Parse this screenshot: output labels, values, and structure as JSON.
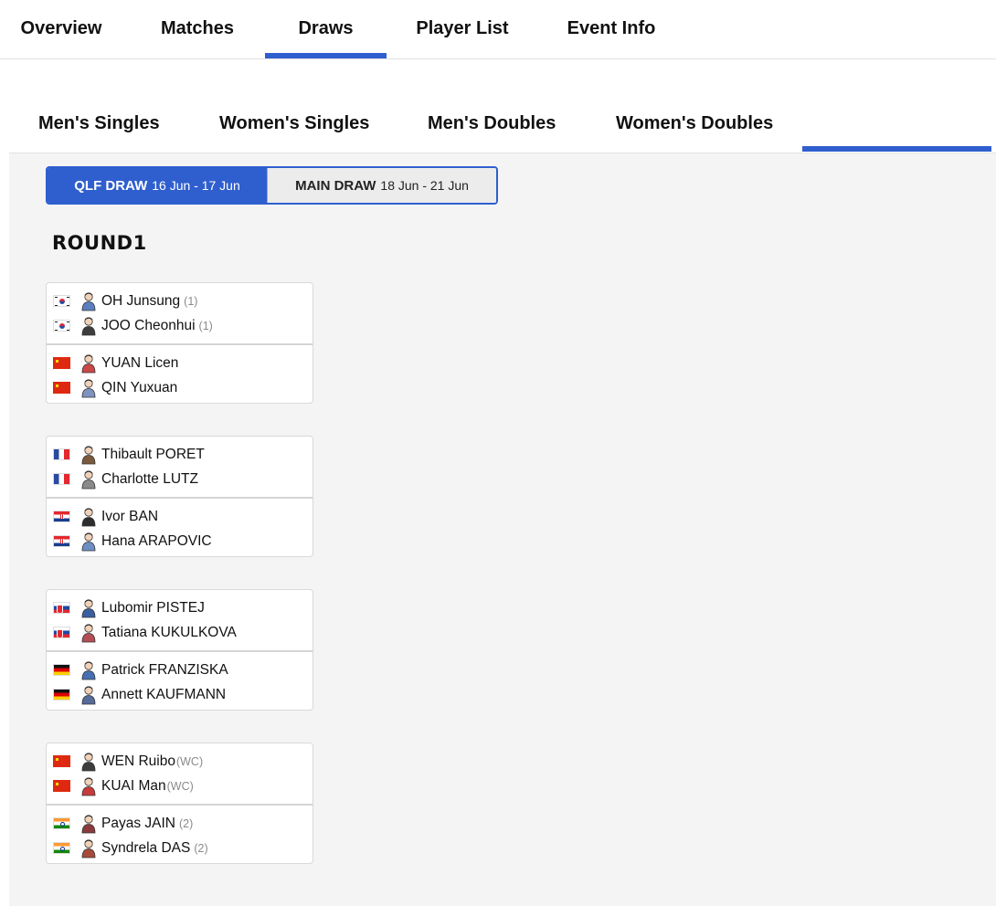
{
  "top_tabs": [
    "Overview",
    "Matches",
    "Draws",
    "Player List",
    "Event Info"
  ],
  "active_top_tab": "Draws",
  "sub_tabs": [
    "Men's Singles",
    "Women's Singles",
    "Men's Doubles",
    "Women's Doubles"
  ],
  "accent_color": "#2f5fce",
  "draw_toggle": {
    "qlf": {
      "label": "QLF DRAW",
      "dates": "16 Jun - 17 Jun"
    },
    "main": {
      "label": "MAIN DRAW",
      "dates": "18 Jun - 21 Jun"
    }
  },
  "round_title": "ROUND1",
  "matches": [
    {
      "team1": [
        {
          "flag": "KOR",
          "name": "OH Junsung",
          "seed": "(1)"
        },
        {
          "flag": "KOR",
          "name": "JOO Cheonhui",
          "seed": "(1)"
        }
      ],
      "team2": [
        {
          "flag": "CHN",
          "name": "YUAN Licen",
          "seed": ""
        },
        {
          "flag": "CHN",
          "name": "QIN Yuxuan",
          "seed": ""
        }
      ]
    },
    {
      "team1": [
        {
          "flag": "FRA",
          "name": "Thibault PORET",
          "seed": ""
        },
        {
          "flag": "FRA",
          "name": "Charlotte LUTZ",
          "seed": ""
        }
      ],
      "team2": [
        {
          "flag": "CRO",
          "name": "Ivor BAN",
          "seed": ""
        },
        {
          "flag": "CRO",
          "name": "Hana ARAPOVIC",
          "seed": ""
        }
      ]
    },
    {
      "team1": [
        {
          "flag": "SVK",
          "name": "Lubomir PISTEJ",
          "seed": ""
        },
        {
          "flag": "SVK",
          "name": "Tatiana KUKULKOVA",
          "seed": ""
        }
      ],
      "team2": [
        {
          "flag": "GER",
          "name": "Patrick FRANZISKA",
          "seed": ""
        },
        {
          "flag": "GER",
          "name": "Annett KAUFMANN",
          "seed": ""
        }
      ]
    },
    {
      "team1": [
        {
          "flag": "CHN",
          "name": "WEN Ruibo",
          "seed": "(WC)"
        },
        {
          "flag": "CHN",
          "name": "KUAI Man",
          "seed": "(WC)"
        }
      ],
      "team2": [
        {
          "flag": "IND",
          "name": "Payas JAIN",
          "seed": "(2)"
        },
        {
          "flag": "IND",
          "name": "Syndrela DAS",
          "seed": "(2)"
        }
      ]
    }
  ]
}
